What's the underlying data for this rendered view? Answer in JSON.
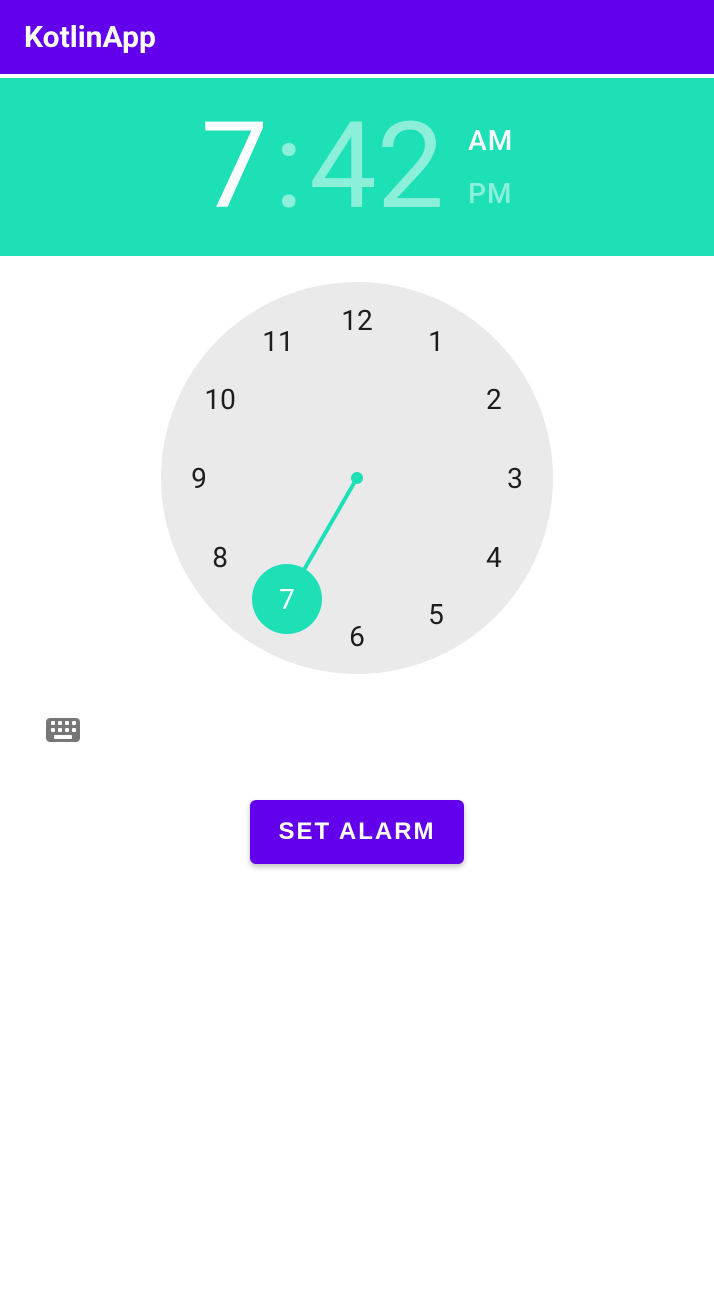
{
  "app": {
    "title": "KotlinApp"
  },
  "time": {
    "hour": "7",
    "separator": ":",
    "minute": "42",
    "am_label": "AM",
    "pm_label": "PM",
    "period": "AM"
  },
  "clock": {
    "labels": [
      "12",
      "1",
      "2",
      "3",
      "4",
      "5",
      "6",
      "7",
      "8",
      "9",
      "10",
      "11"
    ],
    "selected_hour": 7
  },
  "controls": {
    "keyboard_toggle": "keyboard",
    "set_button": "SET ALARM"
  },
  "colors": {
    "primary": "#6200EE",
    "accent": "#1DE0B7",
    "accent_faded": "#8BEFDA",
    "face": "#EAEAEA"
  }
}
